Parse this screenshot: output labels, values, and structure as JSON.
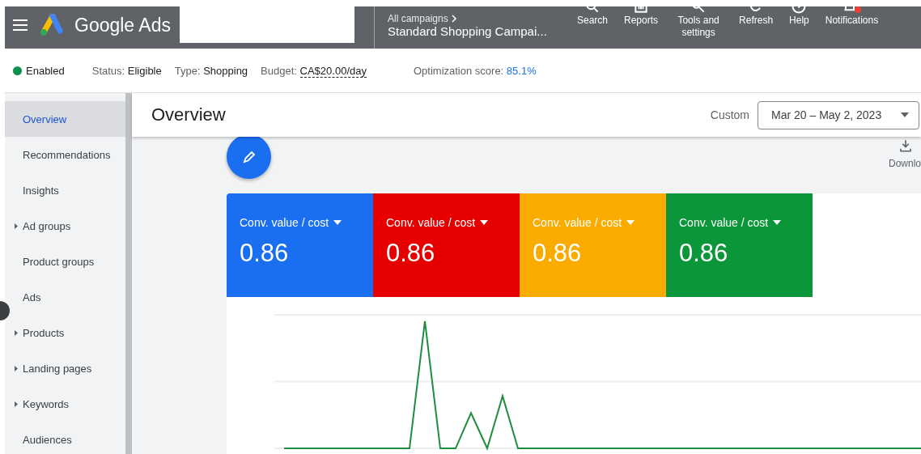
{
  "top_bar": {
    "product": "Google Ads",
    "breadcrumb": "All campaigns",
    "campaign": "Standard Shopping Campai...",
    "actions": [
      {
        "kind": "search",
        "label": "Search"
      },
      {
        "kind": "reports",
        "label": "Reports"
      },
      {
        "kind": "tools",
        "label": "Tools and settings"
      },
      {
        "kind": "refresh",
        "label": "Refresh"
      },
      {
        "kind": "help",
        "label": "Help"
      },
      {
        "kind": "notifications",
        "label": "Notifications",
        "badge": true
      }
    ]
  },
  "status_row": {
    "state": {
      "label": "Enabled",
      "color": "#0d904f"
    },
    "fields": [
      {
        "kind": "plain",
        "label": "Status:",
        "value": "Eligible"
      },
      {
        "kind": "plain",
        "label": "Type:",
        "value": "Shopping"
      },
      {
        "kind": "dotted",
        "label": "Budget:",
        "value": "CA$20.00/day"
      },
      {
        "kind": "score",
        "label": "Optimization score:",
        "value": "85.1%"
      }
    ]
  },
  "sidebar": {
    "items": [
      {
        "label": "Overview",
        "selected": true,
        "expandable": false
      },
      {
        "label": "Recommendations",
        "selected": false,
        "expandable": false
      },
      {
        "label": "Insights",
        "selected": false,
        "expandable": false
      },
      {
        "label": "Ad groups",
        "selected": false,
        "expandable": true
      },
      {
        "label": "Product groups",
        "selected": false,
        "expandable": false
      },
      {
        "label": "Ads",
        "selected": false,
        "expandable": false
      },
      {
        "label": "Products",
        "selected": false,
        "expandable": true
      },
      {
        "label": "Landing pages",
        "selected": false,
        "expandable": true
      },
      {
        "label": "Keywords",
        "selected": false,
        "expandable": true
      },
      {
        "label": "Audiences",
        "selected": false,
        "expandable": false
      }
    ]
  },
  "header": {
    "title": "Overview",
    "range_label": "Custom",
    "date_range": "Mar 20 – May 2, 2023"
  },
  "toolbar": {
    "download": "Downlo"
  },
  "metrics": [
    {
      "label": "Conv. value / cost",
      "value": "0.86",
      "color": "#1a6ef0"
    },
    {
      "label": "Conv. value / cost",
      "value": "0.86",
      "color": "#e60000"
    },
    {
      "label": "Conv. value / cost",
      "value": "0.86",
      "color": "#f9ab00"
    },
    {
      "label": "Conv. value / cost",
      "value": "0.86",
      "color": "#0b9639"
    }
  ]
}
